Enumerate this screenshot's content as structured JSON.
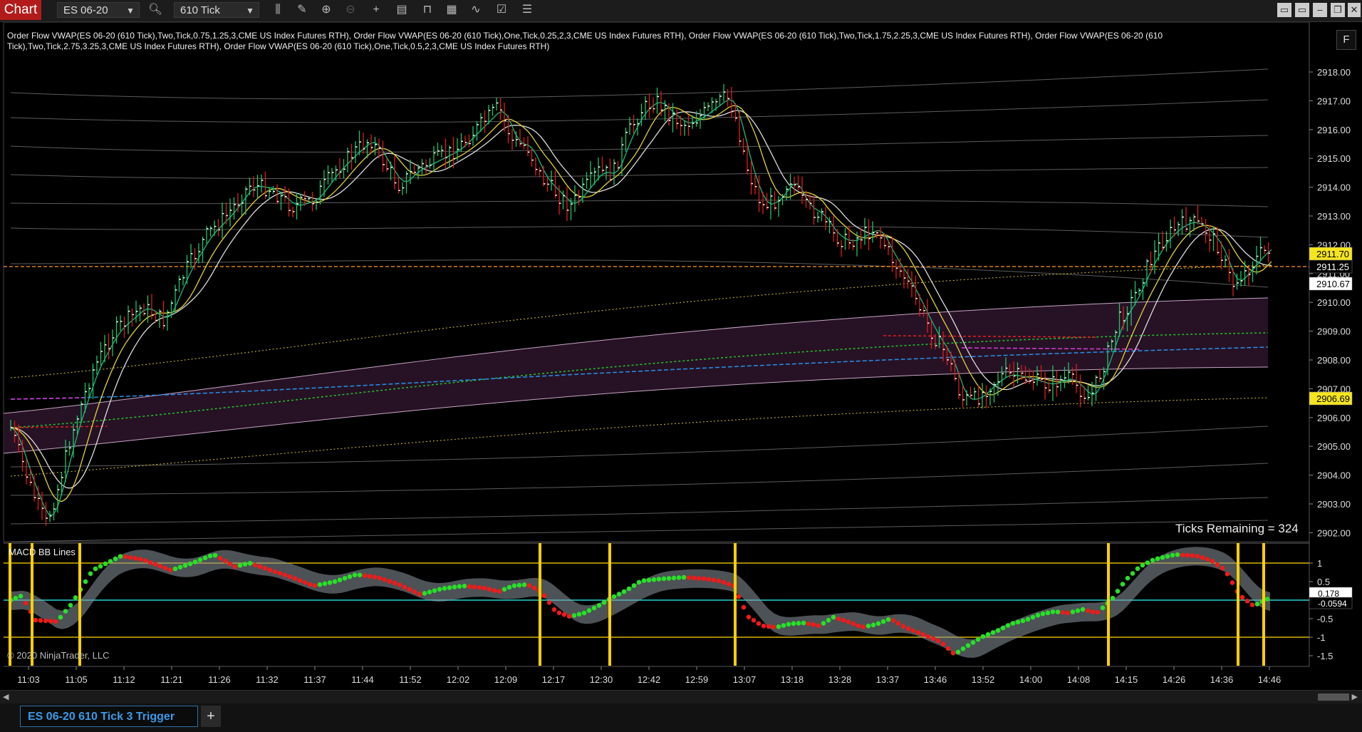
{
  "toolbar": {
    "chart_label": "Chart",
    "instrument": "ES 06-20",
    "interval": "610 Tick"
  },
  "legend_text": "Order Flow VWAP(ES 06-20 (610 Tick),Two,Tick,0.75,1.25,3,CME US Index Futures RTH), Order Flow VWAP(ES 06-20 (610 Tick),One,Tick,0.25,2,3,CME US Index Futures RTH), Order Flow VWAP(ES 06-20 (610 Tick),Two,Tick,1.75,2.25,3,CME US Index Futures RTH), Order Flow VWAP(ES 06-20 (610 Tick),Two,Tick,2.75,3.25,3,CME US Index Futures RTH), Order Flow VWAP(ES 06-20 (610 Tick),One,Tick,0.5,2,3,CME US Index Futures RTH)",
  "price_axis": [
    "2918.00",
    "2917.00",
    "2916.00",
    "2915.00",
    "2914.00",
    "2913.00",
    "2912.00",
    "2911.00",
    "2910.00",
    "2909.00",
    "2908.00",
    "2907.00",
    "2906.00",
    "2905.00",
    "2904.00",
    "2903.00",
    "2902.00"
  ],
  "price_markers": [
    {
      "label": "2911.70",
      "bg": "#f5e51e",
      "fg": "#000"
    },
    {
      "label": "2911.25",
      "bg": "#000000",
      "fg": "#ffffff"
    },
    {
      "label": "2910.67",
      "bg": "#ffffff",
      "fg": "#000"
    },
    {
      "label": "2906.69",
      "bg": "#f5e51e",
      "fg": "#000"
    }
  ],
  "ticks_remaining": "Ticks Remaining = 324",
  "macd": {
    "label": "MACD BB Lines",
    "axis": [
      "1",
      "0.5",
      "0",
      "-0.5",
      "-1",
      "-1.5"
    ],
    "markers": [
      "0.178",
      "-0.0594"
    ]
  },
  "time_axis": [
    "11:03",
    "11:05",
    "11:12",
    "11:21",
    "11:26",
    "11:32",
    "11:37",
    "11:44",
    "11:52",
    "12:02",
    "12:09",
    "12:17",
    "12:30",
    "12:42",
    "12:59",
    "13:07",
    "13:18",
    "13:28",
    "13:37",
    "13:46",
    "13:52",
    "14:00",
    "14:08",
    "14:15",
    "14:26",
    "14:36",
    "14:46"
  ],
  "copyright": "© 2020 NinjaTrader, LLC",
  "fbutton": "F",
  "tab": {
    "label": "ES 06-20 610 Tick 3 Trigger",
    "add": "+"
  },
  "colors": {
    "up": "#1fc46a",
    "down": "#e31b1b",
    "ema_fast": "#1db87a",
    "ema_slow": "#e2d23a",
    "ema_white": "#dddddd",
    "vwap_blue": "#2a8fe8",
    "vwap_green": "#25c12e",
    "vwap_magenta": "#d83ad8",
    "trigger": "#ffd000"
  }
}
